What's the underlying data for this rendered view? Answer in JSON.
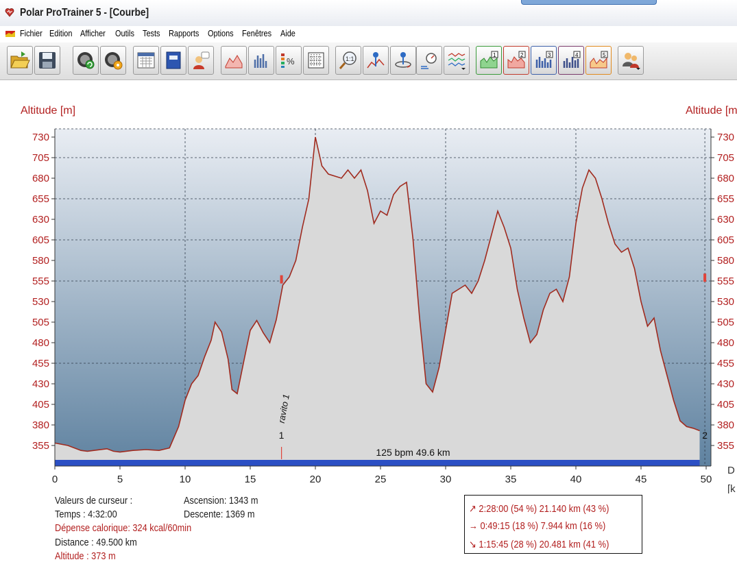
{
  "window": {
    "title": "Polar ProTrainer 5 - [Courbe]"
  },
  "menu": [
    "Fichier",
    "Edition",
    "Afficher",
    "Outils",
    "Tests",
    "Rapports",
    "Options",
    "Fenêtres",
    "Aide"
  ],
  "toolbar_icons": [
    "open-folder-icon",
    "save-disk-icon",
    "sync-watch-icon",
    "watch-settings-icon",
    "calendar-icon",
    "diary-book-icon",
    "user-profile-icon",
    "curve-view-icon",
    "histogram-view-icon",
    "percent-view-icon",
    "table-view-icon",
    "zoom-1to1-icon",
    "info-curve-icon",
    "info-lap-icon",
    "speed-compare-icon",
    "multi-curve-icon",
    "curve-1-icon",
    "curve-2-icon",
    "curve-3-icon",
    "curve-4-icon",
    "curve-5-icon",
    "users-icon"
  ],
  "chart_data": {
    "type": "area",
    "ylabel_left": "Altitude  [m]",
    "ylabel_right": "Altitude  [m",
    "xlabel_right": "D",
    "xunit_right": "[k",
    "ylim": [
      330,
      740
    ],
    "xlim": [
      0,
      50
    ],
    "y_ticks": [
      355,
      380,
      405,
      430,
      455,
      480,
      505,
      530,
      555,
      580,
      605,
      630,
      655,
      680,
      705,
      730
    ],
    "x_ticks": [
      0,
      5,
      10,
      15,
      20,
      25,
      30,
      35,
      40,
      45,
      50
    ],
    "grid": true,
    "line_color": "#a02a1e",
    "fill_color": "#d9d9d9",
    "series": [
      {
        "x": [
          0,
          1,
          2,
          2.5,
          3,
          4,
          4.5,
          5,
          6,
          7,
          8,
          8.8,
          9.5,
          10,
          10.5,
          11,
          11.5,
          12,
          12.3,
          12.8,
          13.3,
          13.6,
          14,
          14.5,
          15,
          15.5,
          16,
          16.5,
          17,
          17.5,
          18,
          18.5,
          19,
          19.5,
          20,
          20.5,
          21,
          22,
          22.5,
          23,
          23.5,
          24,
          24.5,
          25,
          25.5,
          26,
          26.5,
          27,
          27.5,
          28,
          28.5,
          29,
          29.5,
          30,
          30.5,
          31,
          31.5,
          32,
          32.5,
          33,
          33.5,
          34,
          34.5,
          35,
          35.5,
          36,
          36.5,
          37,
          37.5,
          38,
          38.5,
          39,
          39.5,
          40,
          40.5,
          41,
          41.5,
          42,
          42.5,
          43,
          43.5,
          44,
          44.5,
          45,
          45.5,
          46,
          46.5,
          47,
          47.5,
          48,
          48.5,
          49,
          49.5
        ],
        "y": [
          358,
          355,
          349,
          348,
          349,
          351,
          348,
          347,
          349,
          350,
          349,
          352,
          378,
          410,
          430,
          440,
          463,
          483,
          505,
          493,
          460,
          423,
          418,
          457,
          495,
          507,
          492,
          480,
          508,
          550,
          560,
          580,
          620,
          655,
          730,
          695,
          685,
          680,
          690,
          680,
          690,
          665,
          625,
          640,
          635,
          660,
          670,
          675,
          605,
          510,
          430,
          420,
          450,
          495,
          540,
          545,
          550,
          540,
          555,
          580,
          610,
          640,
          620,
          595,
          545,
          510,
          480,
          490,
          520,
          540,
          545,
          530,
          560,
          625,
          668,
          690,
          680,
          655,
          625,
          600,
          590,
          595,
          570,
          530,
          500,
          510,
          470,
          440,
          410,
          385,
          378,
          376,
          373
        ]
      }
    ],
    "annotations": [
      {
        "text": "ravito 1",
        "x": 17.4
      },
      {
        "text": "1",
        "x": 17.4
      },
      {
        "text": "2",
        "x": 49.8
      },
      {
        "text": "125 bpm 49.6 km",
        "x": 27.5
      }
    ],
    "markers": [
      {
        "x": 17.4,
        "y": 557
      },
      {
        "x": 49.9,
        "y": 559
      }
    ]
  },
  "cursor_values": {
    "header": "Valeurs de curseur :",
    "temps": "Temps : 4:32:00",
    "calories": "Dépense calorique: 324 kcal/60min",
    "distance": "Distance : 49.500 km",
    "altitude": "Altitude : 373 m",
    "ascension": "Ascension: 1343 m",
    "descente": "Descente: 1369 m"
  },
  "stats": {
    "up": "↗ 2:28:00  (54 %) 21.140 km  (43 %)",
    "flat": "→ 0:49:15  (18 %)    7.944 km  (16 %)",
    "down": "↘ 1:15:45  (28 %) 20.481 km  (41 %)"
  },
  "colors": {
    "axis_text": "#b21f1f",
    "plot_bg_top": "#e9edf3",
    "plot_bg_bottom": "#5f82a0",
    "distance_bar": "#2b4fc4"
  }
}
